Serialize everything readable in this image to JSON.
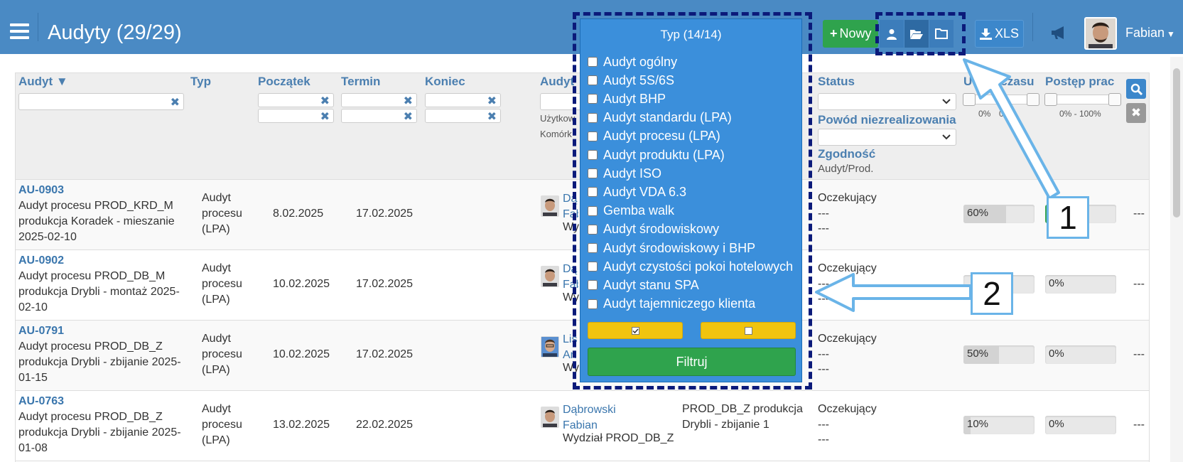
{
  "header": {
    "title": "Audyty (29/29)",
    "new_button": "Nowy",
    "xls_button": "XLS",
    "user_name": "Fabian",
    "colors": {
      "bar": "#4a8ac4",
      "new_button": "#2fa34d"
    }
  },
  "table": {
    "columns": {
      "audit": "Audyt ▼",
      "type": "Typ",
      "start": "Początek",
      "deadline": "Termin",
      "end": "Koniec",
      "auditor": "Audyt",
      "auditor_user": "Użytkow",
      "auditor_cell": "Komórk",
      "status": "Status",
      "reason": "Powód niezrealizowania",
      "compliance": "Zgodność",
      "compliance_sub": "Audyt/Prod.",
      "time_usage": "U",
      "time_usage_suffix": "czasu",
      "time_range": "0%",
      "time_range_right": "00%",
      "work_progress": "Postęp prac",
      "work_range": "0% - 100%"
    },
    "rows": [
      {
        "code": "AU-0903",
        "title": "Audyt procesu PROD_KRD_M produkcja Koradek - mieszanie 2025-02-10",
        "type": "Audyt procesu (LPA)",
        "start": "8.02.2025",
        "deadline": "17.02.2025",
        "auditor_name": "Dą Fab",
        "auditor_dept": "Wy",
        "status": "Oczekujący",
        "reason": "---",
        "compliance": "---",
        "time_pct": 60,
        "time_label": "60%",
        "work_pct": 0,
        "work_label": "",
        "end": "---"
      },
      {
        "code": "AU-0902",
        "title": "Audyt procesu PROD_DB_M produkcja Drybli - montaż 2025-02-10",
        "type": "Audyt procesu (LPA)",
        "start": "10.02.2025",
        "deadline": "17.02.2025",
        "auditor_name": "Dą Fab",
        "auditor_dept": "Wy",
        "status": "Oczekujący",
        "reason": "---",
        "compliance": "---",
        "time_pct": 0,
        "time_label": "",
        "work_pct": 0,
        "work_label": "0%",
        "end": "---"
      },
      {
        "code": "AU-0791",
        "title": "Audyt procesu PROD_DB_Z produkcja Drybli - zbijanie 2025-01-15",
        "type": "Audyt procesu (LPA)",
        "start": "10.02.2025",
        "deadline": "17.02.2025",
        "auditor_name": "Lis An",
        "auditor_dept": "Wy",
        "status": "Oczekujący",
        "reason": "---",
        "compliance": "---",
        "time_pct": 50,
        "time_label": "50%",
        "work_pct": 0,
        "work_label": "0%",
        "end": "---"
      },
      {
        "code": "AU-0763",
        "title": "Audyt procesu PROD_DB_Z produkcja Drybli - zbijanie 2025-01-08",
        "type": "Audyt procesu (LPA)",
        "start": "13.02.2025",
        "deadline": "22.02.2025",
        "auditor_name": "Dąbrowski Fabian",
        "auditor_dept": "Wydział PROD_DB_Z",
        "cell_name": "PROD_DB_Z produkcja Drybli - zbijanie 1",
        "status": "Oczekujący",
        "reason": "---",
        "compliance": "---",
        "time_pct": 10,
        "time_label": "10%",
        "work_pct": 0,
        "work_label": "0%",
        "end": "---"
      }
    ]
  },
  "type_filter": {
    "title": "Typ (14/14)",
    "options": [
      "Audyt ogólny",
      "Audyt 5S/6S",
      "Audyt BHP",
      "Audyt standardu (LPA)",
      "Audyt procesu (LPA)",
      "Audyt produktu (LPA)",
      "Audyt ISO",
      "Audyt VDA 6.3",
      "Gemba walk",
      "Audyt środowiskowy",
      "Audyt środowiskowy i BHP",
      "Audyt czystości pokoi hotelowych",
      "Audyt stanu SPA",
      "Audyt tajemniczego klienta"
    ],
    "filter_button": "Filtruj"
  },
  "callouts": {
    "one": "1",
    "two": "2"
  }
}
